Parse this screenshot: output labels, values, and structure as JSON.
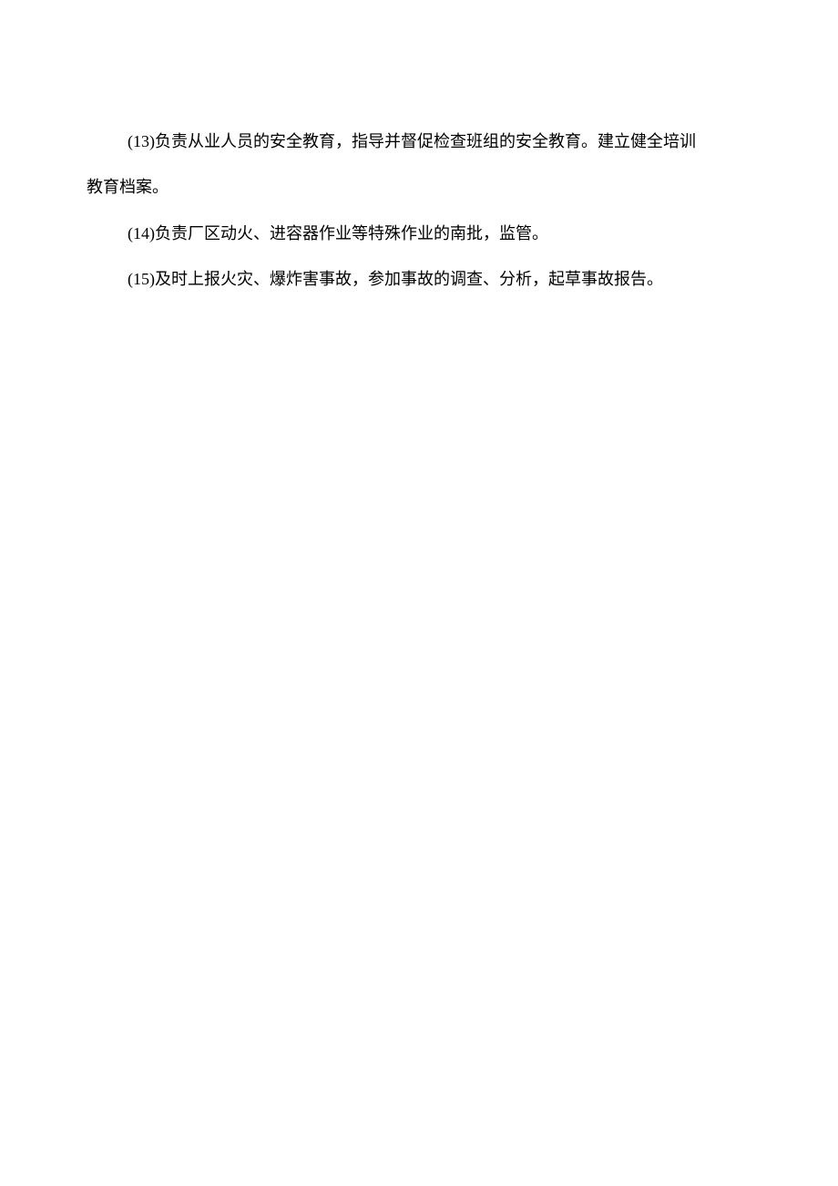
{
  "paragraphs": {
    "p1_line1": "(13)负责从业人员的安全教育，指导并督促检查班组的安全教育。建立健全培训",
    "p1_line2": "教育档案。",
    "p2": "(14)负责厂区动火、进容器作业等特殊作业的南批，监管。",
    "p3": "(15)及时上报火灾、爆炸害事故，参加事故的调查、分析，起草事故报告。"
  }
}
